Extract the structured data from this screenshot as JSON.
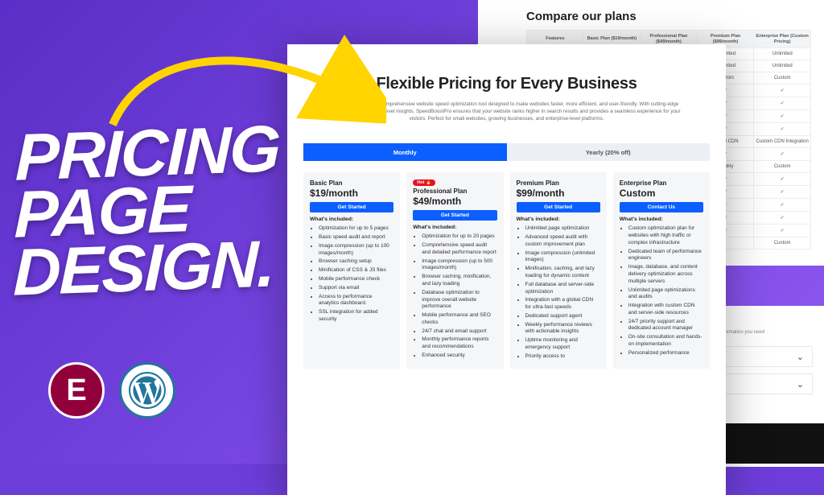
{
  "promo": {
    "line1": "PRICING",
    "line2": "PAGE",
    "line3": "DESIGN.",
    "elementor_letter": "E"
  },
  "page": {
    "title": "Flexible Pricing for Every Business",
    "subtitle": "SpeedBoostPro is a comprehensive website speed optimization tool designed to make websites faster, more efficient, and user-friendly. With cutting-edge technology and expert-level insights, SpeedBoostPro ensures that your website ranks higher in search results and provides a seamless experience for your visitors. Perfect for small websites, growing businesses, and enterprise-level platforms.",
    "tabs": {
      "monthly": "Monthly",
      "yearly": "Yearly (20% off)"
    },
    "included_label": "What's included:",
    "badge_hot": "Hot 🔥",
    "plans": [
      {
        "name": "Basic Plan",
        "price": "$19/month",
        "cta": "Get Started",
        "features": [
          "Optimization for up to 5 pages",
          "Basic speed audit and report",
          "Image compression (up to 100 images/month)",
          "Browser caching setup",
          "Minification of CSS & JS files",
          "Mobile performance check",
          "Support via email",
          "Access to performance analytics dashboard.",
          "SSL integration for added security"
        ]
      },
      {
        "name": "Professional Plan",
        "price": "$49/month",
        "cta": "Get Started",
        "hot": true,
        "features": [
          "Optimization for up to 20 pages",
          "Comprehensive speed audit and detailed performance report",
          "Image compression (up to 500 images/month)",
          "Browser caching, minification, and lazy loading",
          "Database optimization to improve overall website performance",
          "Mobile performance and SEO checks",
          "24/7 chat and email support",
          "Monthly performance reports and recommendations",
          "Enhanced security"
        ]
      },
      {
        "name": "Premium Plan",
        "price": "$99/month",
        "cta": "Get Started",
        "features": [
          "Unlimited page optimization",
          "Advanced speed audit with custom improvement plan",
          "Image compression (unlimited images)",
          "Minification, caching, and lazy loading for dynamic content",
          "Full database and server-side optimization",
          "Integration with a global CDN for ultra-fast speeds",
          "Dedicated support agent",
          "Weekly performance reviews with actionable insights",
          "Uptime monitoring and emergency support",
          "Priority access to"
        ]
      },
      {
        "name": "Enterprise Plan",
        "price": "Custom",
        "cta": "Contact Us",
        "features": [
          "Custom optimization plan for websites with high traffic or complex infrastructure",
          "Dedicated team of performance engineers",
          "Image, database, and content delivery optimization across multiple servers",
          "Unlimited page optimizations and audits",
          "Integration with custom CDN and server-side resources",
          "24/7 priority support and dedicated account manager",
          "On-site consultation and hands-on implementation",
          "Personalized performance"
        ]
      }
    ]
  },
  "compare": {
    "title": "Compare our plans",
    "headers": [
      "Features",
      "Basic Plan ($19/month)",
      "Professional Plan ($49/month)",
      "Premium Plan ($99/month)",
      "Enterprise Plan (Custom Pricing)"
    ],
    "rows": [
      [
        "",
        "",
        "",
        "Unlimited",
        "Unlimited"
      ],
      [
        "",
        "",
        "",
        "Unlimited",
        "Unlimited"
      ],
      [
        "",
        "",
        "",
        "Custom",
        "Custom"
      ],
      [
        "",
        "",
        "",
        "✓",
        "✓"
      ],
      [
        "",
        "",
        "",
        "✓",
        "✓"
      ],
      [
        "",
        "",
        "",
        "✓",
        "✓"
      ],
      [
        "",
        "",
        "",
        "✓",
        "✓"
      ],
      [
        "",
        "",
        "",
        "Global CDN",
        "Custom CDN Integration"
      ],
      [
        "",
        "",
        "",
        "✓",
        "✓"
      ],
      [
        "",
        "",
        "",
        "Weekly",
        "Custom"
      ],
      [
        "",
        "",
        "",
        "✓",
        "✓"
      ],
      [
        "",
        "",
        "",
        "✓",
        "✓"
      ],
      [
        "",
        "",
        "",
        "✗",
        "✓"
      ],
      [
        "",
        "",
        "",
        "✗",
        "✓"
      ],
      [
        "",
        "",
        "",
        "✗",
        "✓"
      ],
      [
        "",
        "",
        "",
        "",
        "Custom"
      ]
    ]
  },
  "faq": {
    "title_fragment": "estions",
    "sub_fragment": "to help you get the information you need",
    "chevron": "⌄"
  }
}
